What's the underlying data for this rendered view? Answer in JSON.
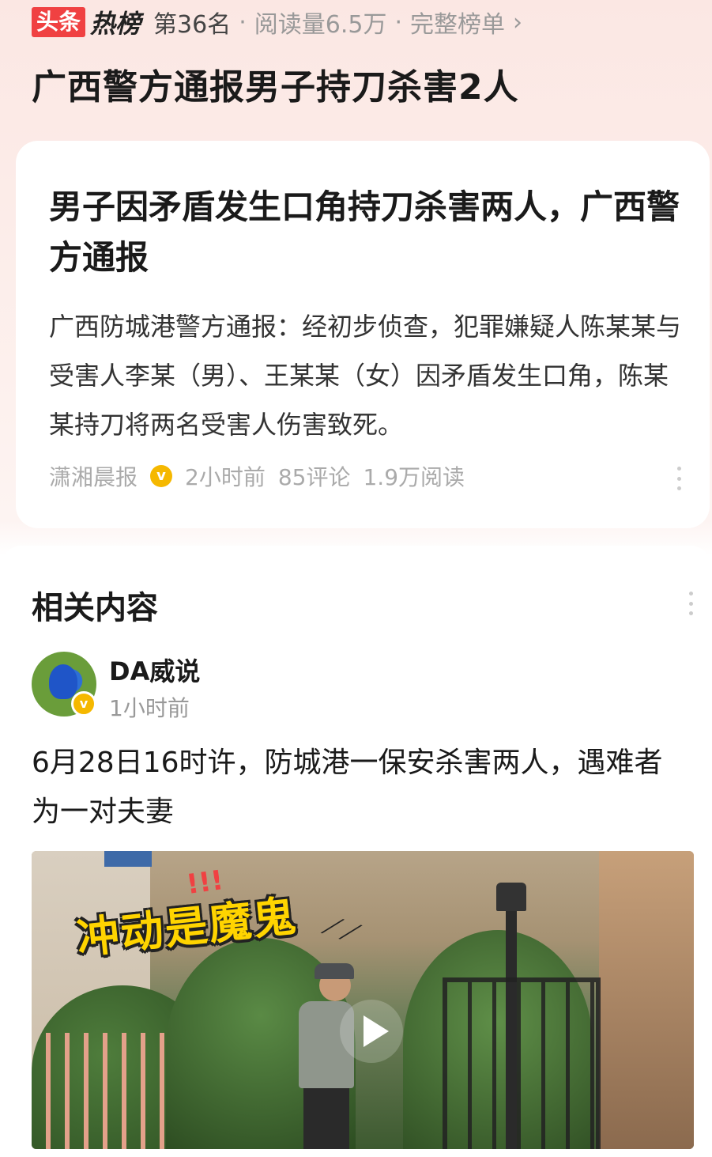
{
  "hot_list": {
    "brand_toutiao": "头条",
    "brand_hot": "热榜",
    "rank": "第36名",
    "dot1": "·",
    "read_count": "阅读量6.5万",
    "dot2": "·",
    "full_list": "完整榜单",
    "chevron": "›",
    "topic_title": "广西警方通报男子持刀杀害2人"
  },
  "news_card": {
    "title": "男子因矛盾发生口角持刀杀害两人，广西警方通报",
    "body": "广西防城港警方通报：经初步侦查，犯罪嫌疑人陈某某与受害人李某（男）、王某某（女）因矛盾发生口角，陈某某持刀将两名受害人伤害致死。",
    "source": "潇湘晨报",
    "verified_badge": "v",
    "time": "2小时前",
    "comments": "85评论",
    "reads": "1.9万阅读"
  },
  "related": {
    "section_title": "相关内容",
    "author_name": "DA威说",
    "author_badge": "v",
    "author_time": "1小时前",
    "post_text": "6月28日16时许，防城港一保安杀害两人，遇难者为一对夫妻",
    "video_caption": "冲动是魔鬼",
    "video_caption_marks": "!!!"
  },
  "colors": {
    "brand_red": "#f04142",
    "verified_gold": "#f5b800",
    "caption_yellow": "#ffd400"
  },
  "icons": {
    "more": "more-vertical-icon",
    "play": "play-icon",
    "verified": "verified-badge-icon",
    "chevron": "chevron-right-icon"
  }
}
